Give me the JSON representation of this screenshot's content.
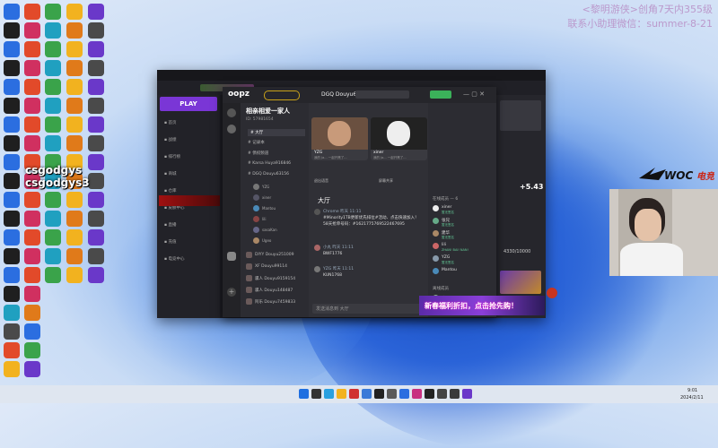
{
  "overlay": {
    "line1": "<黎明游侠>创角7天内355级",
    "line2": "联系小助理微信：summer-8-21"
  },
  "csgo": {
    "line1": "csgodgys",
    "line2": "csgodgys3"
  },
  "launcher": {
    "play_label": "PLAY",
    "side_items": [
      "首页",
      "战绩",
      "排行榜",
      "商城",
      "仓库",
      "皮肤中心",
      "直播",
      "充值",
      "电竞中心"
    ],
    "promo": "+5.43",
    "stat": "4330/10000"
  },
  "oopz": {
    "logo": "oopz",
    "server_name": "相亲相爱一家人",
    "server_id": "ID: 57981654",
    "channel_title": "DGQ Douyu63156",
    "channels": [
      {
        "name": "大厅"
      },
      {
        "name": "记录本"
      },
      {
        "name": "债权频道"
      },
      {
        "name": "Karsa Huya916846"
      },
      {
        "name": "DGQ Douyu63156"
      }
    ],
    "voice_users": [
      "YZG",
      "xiner",
      "Mantou",
      "lili",
      "sasaKan",
      "Ugeo"
    ],
    "channels_lower": [
      {
        "name": "DIYY Douyu251009"
      },
      {
        "name": "XF Douyu99114"
      },
      {
        "name": "骡人 Douyu9159154"
      },
      {
        "name": "骡人 Douyu148487"
      },
      {
        "name": "阿乐 Douyu7459833"
      }
    ],
    "video_cards": [
      {
        "name": "YZG",
        "status": "我的 Ja... 一起开黑了..."
      },
      {
        "name": "xiner",
        "status": "我的 Ja... 一起开黑了..."
      },
      {
        "name": "Mantou",
        "status": "我的 Ja... 一起开黑了..."
      }
    ],
    "controls": [
      "退出语音",
      "屏幕共享"
    ],
    "chat_section": "大厅",
    "messages": [
      {
        "user": "Chrome",
        "time": "昨天 11:11",
        "text": "#Minority1TB更新优先排位#活动、点击快速加入！ 58天抢单号码：#1621775769522467695"
      },
      {
        "user": "小丸",
        "time": "昨天 11:11",
        "text": "BWF1776"
      },
      {
        "user": "YZG",
        "time": "昨天 11:11",
        "text": "KUN1768"
      }
    ],
    "input_placeholder": "发送消息到 大厅",
    "members_header": "在线成员 — 6",
    "members": [
      {
        "name": "xiner",
        "status": "暂无签名"
      },
      {
        "name": "张兄",
        "status": "暂无签名"
      },
      {
        "name": "建华",
        "status": "暂无签名"
      },
      {
        "name": "lili",
        "status": "ZHAN! BAI! NAN!"
      },
      {
        "name": "YZG",
        "status": "暂无签名"
      },
      {
        "name": "Mantou",
        "status": ""
      }
    ],
    "members_footer": "离线成员",
    "last_member": "建子可"
  },
  "banner": {
    "text": "新春福利折扣，点击抢先购！"
  },
  "taskbar": {
    "time": "9:01",
    "date": "2024/2/11"
  },
  "colors": {
    "accent": "#7a36d6",
    "green": "#3fbf6a",
    "bg": "#2a2a30"
  }
}
